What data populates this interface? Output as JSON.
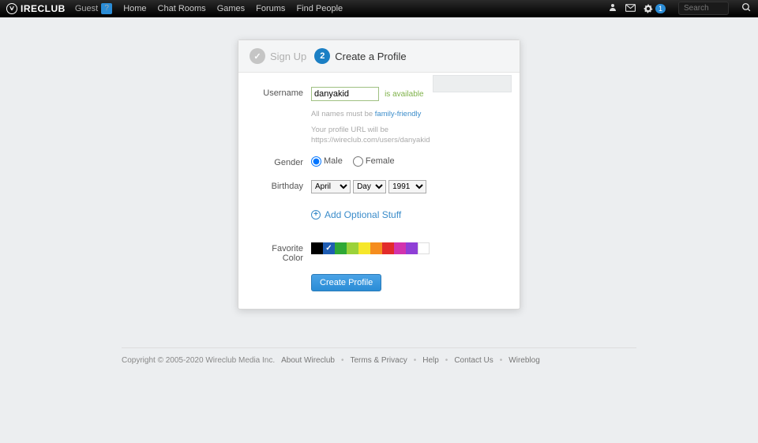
{
  "topbar": {
    "logo_text": "IRECLUB",
    "guest_label": "Guest",
    "help_badge": "?",
    "nav": {
      "home": "Home",
      "chat": "Chat Rooms",
      "games": "Games",
      "forums": "Forums",
      "find": "Find People"
    },
    "notif_count": "1",
    "search_placeholder": "Search"
  },
  "steps": {
    "signup": {
      "icon": "✓",
      "label": "Sign Up"
    },
    "profile": {
      "icon": "2",
      "label": "Create a Profile"
    }
  },
  "form": {
    "username": {
      "label": "Username",
      "value": "danyakid",
      "avail": "is available"
    },
    "hint1_prefix": "All names must be ",
    "hint1_link": "family-friendly",
    "hint2_line1": "Your profile URL will be",
    "hint2_line2": "https://wireclub.com/users/danyakid",
    "gender": {
      "label": "Gender",
      "male": "Male",
      "female": "Female"
    },
    "birthday": {
      "label": "Birthday",
      "month": "April",
      "day": "Day",
      "year": "1991"
    },
    "add_optional": "Add Optional Stuff",
    "favcolor": {
      "label": "Favorite Color"
    },
    "submit": "Create Profile"
  },
  "colors": [
    "#000000",
    "#1f5db3",
    "#2fa836",
    "#9bd23a",
    "#f6e72a",
    "#f58d1e",
    "#e22b2b",
    "#d233ad",
    "#8f3fd6",
    "#ffffff"
  ],
  "selected_color_index": 1,
  "footer": {
    "copyright": "Copyright © 2005-2020 Wireclub Media Inc.",
    "links": {
      "about": "About Wireclub",
      "terms": "Terms & Privacy",
      "help": "Help",
      "contact": "Contact Us",
      "blog": "Wireblog"
    }
  }
}
